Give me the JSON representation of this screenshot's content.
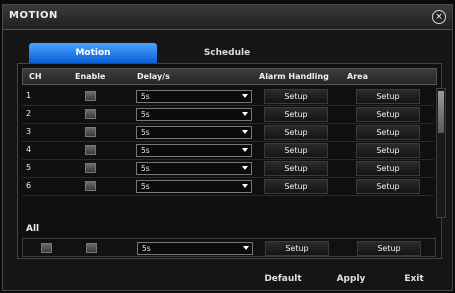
{
  "window": {
    "title": "MOTION",
    "close_icon": "×"
  },
  "tabs": [
    {
      "label": "Motion",
      "active": true
    },
    {
      "label": "Schedule",
      "active": false
    }
  ],
  "table": {
    "headers": [
      "CH",
      "Enable",
      "Delay/s",
      "Alarm Handling",
      "Area"
    ],
    "rows": [
      {
        "ch": "1",
        "delay": "5s",
        "alarm": "Setup",
        "area": "Setup"
      },
      {
        "ch": "2",
        "delay": "5s",
        "alarm": "Setup",
        "area": "Setup"
      },
      {
        "ch": "3",
        "delay": "5s",
        "alarm": "Setup",
        "area": "Setup"
      },
      {
        "ch": "4",
        "delay": "5s",
        "alarm": "Setup",
        "area": "Setup"
      },
      {
        "ch": "5",
        "delay": "5s",
        "alarm": "Setup",
        "area": "Setup"
      },
      {
        "ch": "6",
        "delay": "5s",
        "alarm": "Setup",
        "area": "Setup"
      }
    ]
  },
  "all": {
    "label": "All",
    "delay": "5s",
    "alarm": "Setup",
    "area": "Setup"
  },
  "footer": {
    "default": "Default",
    "apply": "Apply",
    "exit": "Exit"
  },
  "colors": {
    "tab_active": "#1f7ae8",
    "background": "#151515"
  }
}
